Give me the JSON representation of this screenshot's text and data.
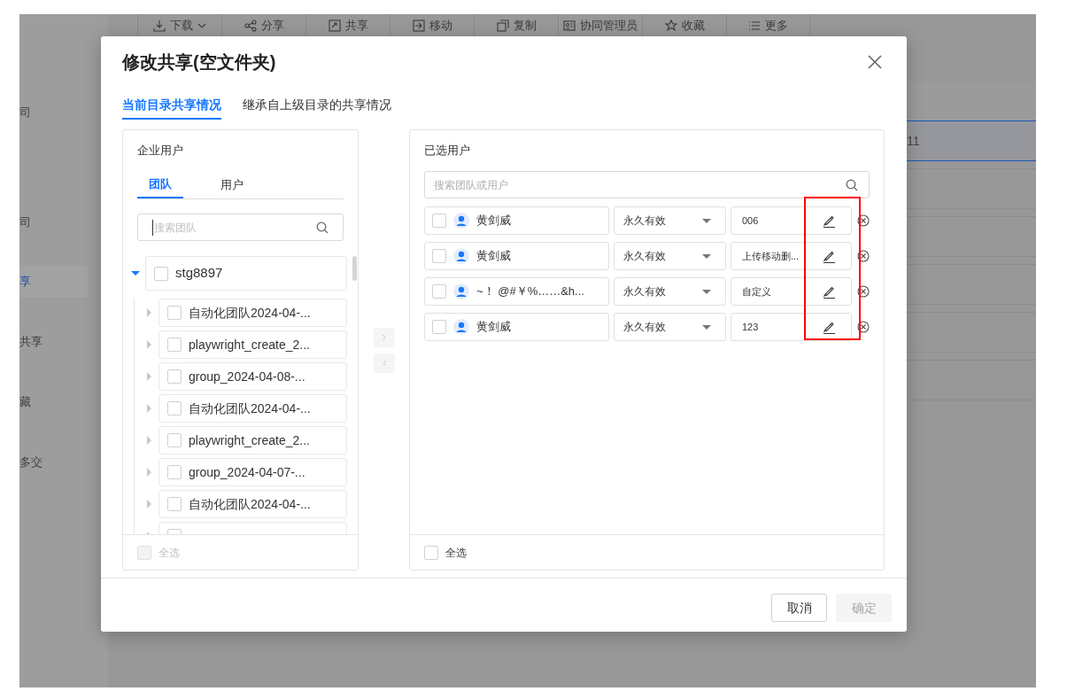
{
  "toolbar": [
    {
      "label": "下载",
      "dropdown": true
    },
    {
      "label": "分享",
      "dropdown": false
    },
    {
      "label": "共享",
      "dropdown": false
    },
    {
      "label": "移动",
      "dropdown": false
    },
    {
      "label": "复制",
      "dropdown": false
    },
    {
      "label": "协同管理员",
      "dropdown": false
    },
    {
      "label": "收藏",
      "dropdown": false
    },
    {
      "label": "更多",
      "dropdown": false
    }
  ],
  "sidebar": {
    "items": [
      {
        "label": "司",
        "selected": false
      },
      {
        "label": "司",
        "selected": false
      },
      {
        "label": "享",
        "selected": true
      },
      {
        "label": "共享",
        "selected": false
      },
      {
        "label": "藏",
        "selected": false
      },
      {
        "label": "多交",
        "selected": false
      }
    ]
  },
  "file_list": {
    "rows": [
      {
        "column_1": "11",
        "selected": true
      },
      {
        "column_1": "",
        "selected": false
      },
      {
        "column_1": "",
        "selected": false
      },
      {
        "column_1": "",
        "selected": false
      },
      {
        "column_1": "",
        "selected": false
      },
      {
        "column_1": "",
        "selected": false
      }
    ]
  },
  "dialog": {
    "title": "修改共享(空文件夹)",
    "tabs": [
      {
        "label": "当前目录共享情况",
        "selected": true
      },
      {
        "label": "继承自上级目录的共享情况",
        "selected": false
      }
    ],
    "left_panel": {
      "title": "企业用户",
      "tabs": [
        {
          "label": "团队",
          "selected": true
        },
        {
          "label": "用户",
          "selected": false
        }
      ],
      "search": {
        "placeholder": "搜索团队"
      },
      "tree": [
        {
          "label": "stg8897",
          "checked": false,
          "expanded": true,
          "children": [
            {
              "label": "自动化团队2024-04-...",
              "checked": false,
              "expanded": false
            },
            {
              "label": "playwright_create_2...",
              "checked": false,
              "expanded": false
            },
            {
              "label": "group_2024-04-08-...",
              "checked": false,
              "expanded": false
            },
            {
              "label": "自动化团队2024-04-...",
              "checked": false,
              "expanded": false
            },
            {
              "label": "playwright_create_2...",
              "checked": false,
              "expanded": false
            },
            {
              "label": "group_2024-04-07-...",
              "checked": false,
              "expanded": false
            },
            {
              "label": "自动化团队2024-04-...",
              "checked": false,
              "expanded": false
            },
            {
              "checked": false,
              "expanded": false
            }
          ]
        }
      ],
      "select_all": {
        "label": "全选",
        "checked": false,
        "disabled": true
      }
    },
    "right_panel": {
      "title": "已选用户",
      "search": {
        "placeholder": "搜索团队或用户"
      },
      "members": [
        {
          "name": "黄剑威",
          "checked": false,
          "validity": "永久有效",
          "permission": "006"
        },
        {
          "name": "黄剑威",
          "checked": false,
          "validity": "永久有效",
          "permission": "上传移动删..."
        },
        {
          "name": "~！ @#￥%……&h...",
          "checked": false,
          "validity": "永久有效",
          "permission": "自定义"
        },
        {
          "name": "黄剑威",
          "checked": false,
          "validity": "永久有效",
          "permission": "123"
        }
      ],
      "select_all": {
        "label": "全选",
        "checked": false,
        "disabled": false
      }
    },
    "buttons": [
      {
        "label": "取消",
        "disabled": false
      },
      {
        "label": "确定",
        "disabled": true
      }
    ]
  }
}
